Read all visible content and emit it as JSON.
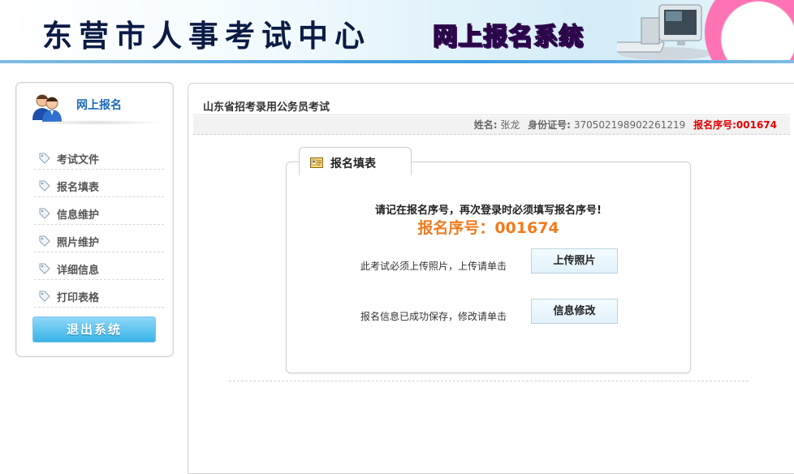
{
  "header": {
    "title": "东营市人事考试中心",
    "subtitle": "网上报名系统"
  },
  "sidebar": {
    "title": "网上报名",
    "items": [
      {
        "label": "考试文件"
      },
      {
        "label": "报名填表"
      },
      {
        "label": "信息维护"
      },
      {
        "label": "照片维护"
      },
      {
        "label": "详细信息"
      },
      {
        "label": "打印表格"
      }
    ],
    "logout_label": "退出系统"
  },
  "main": {
    "exam_title": "山东省招考录用公务员考试",
    "info": {
      "name_label": "姓名:",
      "name_value": "张龙",
      "id_label": "身份证号:",
      "id_value": "370502198902261219",
      "reg_label": "报名序号:",
      "reg_value": "001674"
    },
    "form": {
      "tab_label": "报名填表",
      "notice": "请记在报名序号，再次登录时必须填写报名序号!",
      "reg_display": "报名序号：001674",
      "upload_hint": "此考试必须上传照片，上传请单击",
      "upload_button": "上传照片",
      "modify_hint": "报名信息已成功保存，修改请单击",
      "modify_button": "信息修改"
    }
  },
  "colors": {
    "accent_blue": "#1a6bb8",
    "reg_red": "#e00000",
    "reg_orange": "#f27a1d",
    "subtitle_pink": "#ef2fae"
  }
}
